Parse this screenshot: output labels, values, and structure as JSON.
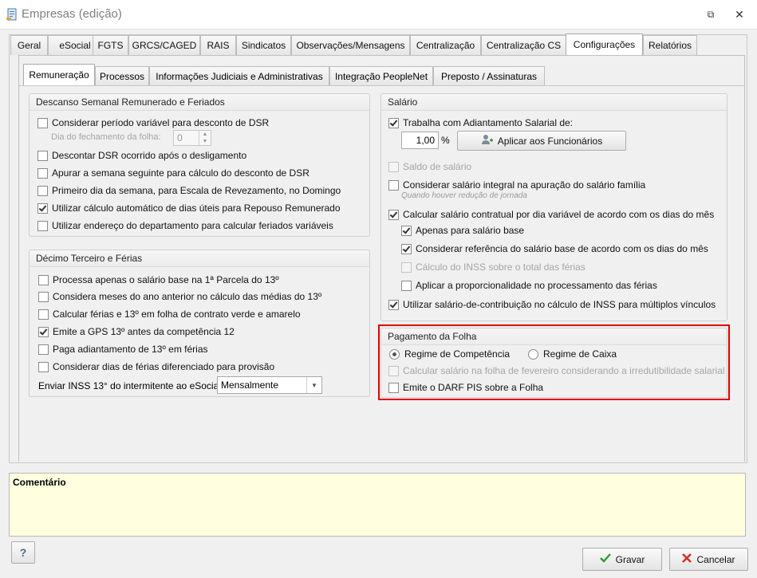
{
  "window": {
    "title": "Empresas (edição)",
    "restore_glyph": "⧉",
    "close_glyph": "✕"
  },
  "main_tabs": [
    {
      "label": "Geral"
    },
    {
      "label": "eSocial"
    },
    {
      "label": "FGTS"
    },
    {
      "label": "GRCS/CAGED"
    },
    {
      "label": "RAIS"
    },
    {
      "label": "Sindicatos"
    },
    {
      "label": "Observações/Mensagens"
    },
    {
      "label": "Centralização"
    },
    {
      "label": "Centralização CS"
    },
    {
      "label": "Configurações",
      "active": true
    },
    {
      "label": "Relatórios"
    }
  ],
  "sub_tabs": [
    {
      "label": "Remuneração",
      "active": true
    },
    {
      "label": "Processos"
    },
    {
      "label": "Informações Judiciais e Administrativas"
    },
    {
      "label": "Integração PeopleNet"
    },
    {
      "label": "Preposto / Assinaturas"
    }
  ],
  "dsr": {
    "title": "Descanso Semanal Remunerado e Feriados",
    "items": [
      {
        "label": "Considerar período variável para desconto de DSR",
        "checked": false
      },
      {
        "label": "Descontar DSR ocorrido após o desligamento",
        "checked": false
      },
      {
        "label": "Apurar a semana seguinte para cálculo do desconto de DSR",
        "checked": false
      },
      {
        "label": "Primeiro dia da semana, para Escala de Revezamento, no Domingo",
        "checked": false
      },
      {
        "label": "Utilizar cálculo automático de dias úteis para Repouso Remunerado",
        "checked": true
      },
      {
        "label": "Utilizar endereço do departamento para calcular feriados variáveis",
        "checked": false
      }
    ],
    "closing_day_label": "Dia do fechamento da folha:",
    "closing_day_value": "0"
  },
  "decimo": {
    "title": "Décimo Terceiro e Férias",
    "items": [
      {
        "label": "Processa apenas o salário base na 1ª Parcela do 13º",
        "checked": false
      },
      {
        "label": "Considera meses do ano anterior no cálculo das médias do 13º",
        "checked": false
      },
      {
        "label": "Calcular férias e 13º em folha de contrato verde e amarelo",
        "checked": false
      },
      {
        "label": "Emite a GPS 13º antes da competência 12",
        "checked": true
      },
      {
        "label": "Paga adiantamento de 13º em férias",
        "checked": false
      },
      {
        "label": "Considerar dias de férias diferenciado para provisão",
        "checked": false
      }
    ],
    "inss_label": "Enviar INSS 13° do intermitente ao eSocial",
    "inss_value": "Mensalmente"
  },
  "salario": {
    "title": "Salário",
    "adiantamento_label": "Trabalha com Adiantamento Salarial de:",
    "adiantamento_checked": true,
    "adiantamento_value": "1,00",
    "percent_sign": "%",
    "apply_button": "Aplicar aos Funcionários",
    "saldo_label": "Saldo de salário",
    "integral_label": "Considerar salário integral na apuração do salário família",
    "integral_hint": "Quando houver redução de jornada",
    "contratual_label": "Calcular salário contratual por dia variável de acordo com os dias do mês",
    "apenas_base_label": "Apenas para salário base",
    "referencia_label": "Considerar referência do salário base de acordo com os dias do mês",
    "inss_total_label": "Cálculo do INSS sobre o total das férias",
    "proporcionalidade_label": "Aplicar a proporcionalidade no processamento das férias",
    "contribuicao_label": "Utilizar salário-de-contribuição no cálculo de INSS para múltiplos vínculos"
  },
  "pagamento": {
    "title": "Pagamento da Folha",
    "regime_competencia": "Regime de Competência",
    "regime_caixa": "Regime de Caixa",
    "fevereiro_label": "Calcular salário na folha de fevereiro considerando a irredutibilidade salarial",
    "darf_label": "Emite o DARF PIS sobre a Folha"
  },
  "comment": {
    "label": "Comentário"
  },
  "footer": {
    "help_label": "?",
    "save_label": "Gravar",
    "cancel_label": "Cancelar"
  },
  "colors": {
    "highlight": "#e00000",
    "comment_bg": "#ffffe0"
  }
}
